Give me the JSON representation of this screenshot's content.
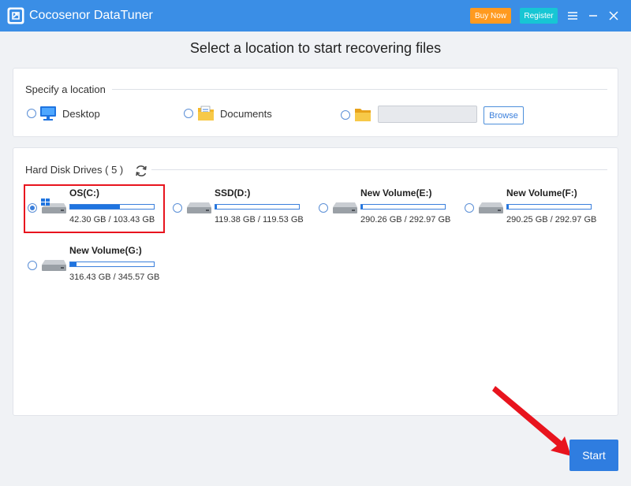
{
  "app": {
    "title": "Cocosenor DataTuner",
    "buy_label": "Buy Now",
    "register_label": "Register",
    "accent_color": "#3a8ee6"
  },
  "heading": "Select a location to start recovering files",
  "location": {
    "section_label": "Specify a location",
    "options": [
      {
        "label": "Desktop",
        "icon": "desktop-icon"
      },
      {
        "label": "Documents",
        "icon": "documents-icon"
      },
      {
        "label": "",
        "icon": "folder-icon"
      }
    ],
    "path_value": "",
    "browse_label": "Browse"
  },
  "drives": {
    "section_label": "Hard Disk Drives ( 5 )",
    "items": [
      {
        "name": "OS(C:)",
        "size": "42.30 GB / 103.43 GB",
        "used_fraction": 0.59,
        "selected": true,
        "icon": "windows-drive-icon"
      },
      {
        "name": "SSD(D:)",
        "size": "119.38 GB / 119.53 GB",
        "used_fraction": 0.001,
        "selected": false,
        "icon": "drive-icon"
      },
      {
        "name": "New Volume(E:)",
        "size": "290.26 GB / 292.97 GB",
        "used_fraction": 0.01,
        "selected": false,
        "icon": "drive-icon"
      },
      {
        "name": "New Volume(F:)",
        "size": "290.25 GB / 292.97 GB",
        "used_fraction": 0.01,
        "selected": false,
        "icon": "drive-icon"
      },
      {
        "name": "New Volume(G:)",
        "size": "316.43 GB / 345.57 GB",
        "used_fraction": 0.08,
        "selected": false,
        "icon": "drive-icon"
      }
    ]
  },
  "start_label": "Start",
  "highlight_color": "#e8141e"
}
